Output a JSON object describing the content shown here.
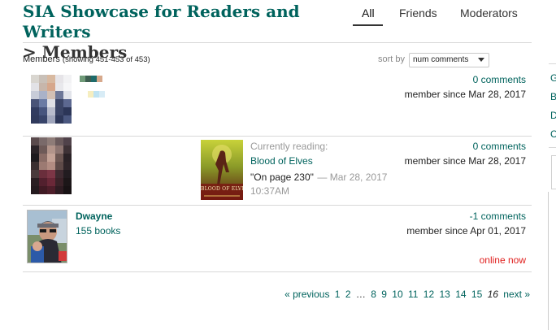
{
  "header": {
    "title_line1": "SIA Showcase for Readers and Writers",
    "title_line2": "> Members",
    "tabs": [
      {
        "label": "All",
        "active": true
      },
      {
        "label": "Friends",
        "active": false
      },
      {
        "label": "Moderators",
        "active": false
      }
    ]
  },
  "summary": {
    "label": "Members",
    "detail": "(showing 451-453 of 453)"
  },
  "sort": {
    "label": "sort by",
    "selected": "num comments"
  },
  "members": [
    {
      "name": "",
      "books": "",
      "comments": "0 comments",
      "since": "member since Mar 28, 2017"
    },
    {
      "name": "",
      "books": "",
      "reading_label": "Currently reading:",
      "book_title": "Blood of Elves",
      "progress_text": "\"On page 230\"",
      "progress_date": "— Mar 28, 2017",
      "progress_time": "10:37AM",
      "cover_text": "BLOOD OF ELVES",
      "comments": "0 comments",
      "since": "member since Mar 28, 2017"
    },
    {
      "name": "Dwayne",
      "books": "155 books",
      "comments": "-1 comments",
      "since": "member since Apr 01, 2017",
      "status": "online now"
    }
  ],
  "pagination": {
    "previous": "« previous",
    "pages": [
      "1",
      "2",
      "…",
      "8",
      "9",
      "10",
      "11",
      "12",
      "13",
      "14",
      "15"
    ],
    "current": "16",
    "next": "next »"
  },
  "sidebar_letters": [
    "G",
    "B",
    "D",
    "C"
  ],
  "colors": {
    "brand_green": "#00635d",
    "online_red": "#e0201e"
  }
}
